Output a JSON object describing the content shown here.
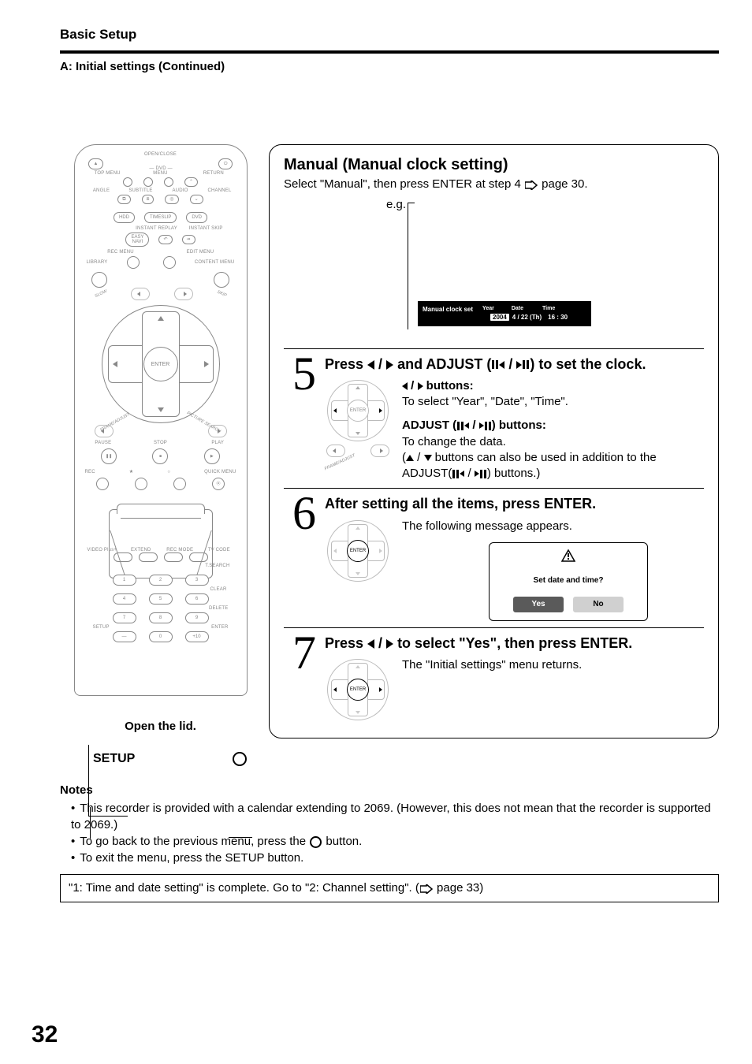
{
  "header": {
    "section": "Basic Setup",
    "subsection": "A: Initial settings (Continued)"
  },
  "remote": {
    "open_close": "OPEN/CLOSE",
    "dvd": "DVD",
    "top_menu": "TOP MENU",
    "menu": "MENU",
    "return": "RETURN",
    "angle": "ANGLE",
    "subtitle": "SUBTITLE",
    "audio": "AUDIO",
    "channel": "CHANNEL",
    "hdd": "HDD",
    "timeslip": "TIMESLIP",
    "dvd2": "DVD",
    "instant_replay": "INSTANT REPLAY",
    "instant_skip": "INSTANT SKIP",
    "easy_navi": "EASY\nNAVI",
    "rec_menu": "REC MENU",
    "edit_menu": "EDIT MENU",
    "library": "LIBRARY",
    "content_menu": "CONTENT MENU",
    "slow": "SLOW",
    "skip": "SKIP",
    "enter": "ENTER",
    "frame_adjust": "FRAME/ADJUST",
    "picture_search": "PICTURE SEARCH",
    "pause": "PAUSE",
    "stop": "STOP",
    "play": "PLAY",
    "rec": "REC",
    "quick_menu": "QUICK MENU",
    "videoplus": "VIDEO Plus+",
    "extend": "EXTEND",
    "rec_mode": "REC MODE",
    "tv_code": "TV CODE",
    "t_search": "T.SEARCH",
    "clear": "CLEAR",
    "delete": "DELETE",
    "setup": "SETUP",
    "enter2": "ENTER",
    "plus10": "+10",
    "nums": [
      "1",
      "2",
      "3",
      "4",
      "5",
      "6",
      "7",
      "8",
      "9",
      "0"
    ]
  },
  "left": {
    "open_lid": "Open the lid.",
    "setup_label": "SETUP"
  },
  "panel": {
    "title": "Manual (Manual clock setting)",
    "lead_pre": "Select \"Manual\", then press ENTER at step 4 ",
    "lead_post": " page 30.",
    "eg": "e.g.",
    "clock": {
      "label": "Manual clock set",
      "year_h": "Year",
      "date_h": "Date",
      "time_h": "Time",
      "year": "2004",
      "date": "4  / 22 (Th)",
      "time": "16 : 30"
    },
    "step5": {
      "num": "5",
      "title_pre": "Press ",
      "title_mid": " and ADJUST (",
      "title_post": ") to set the clock.",
      "btns_label": " buttons:",
      "btns_text": "To select \"Year\", \"Date\", \"Time\".",
      "adjust_label": "ADJUST (",
      "adjust_label_post": ") buttons:",
      "adjust_text1": "To change the data.",
      "adjust_text2_pre": "(",
      "adjust_text2_mid": " buttons can also be used in addition to the ADJUST(",
      "adjust_text2_post": ") buttons.)"
    },
    "step6": {
      "num": "6",
      "title": "After setting all the items, press ENTER.",
      "text": "The following message appears.",
      "confirm_msg": "Set date and time?",
      "yes": "Yes",
      "no": "No"
    },
    "step7": {
      "num": "7",
      "title_pre": "Press ",
      "title_post": " to select \"Yes\", then press ENTER.",
      "text": "The \"Initial settings\" menu returns."
    }
  },
  "notes": {
    "heading": "Notes",
    "n1": "This recorder is provided with a calendar extending to 2069. (However, this does not mean that the recorder is supported to 2069.)",
    "n2_pre": "To go back to the previous menu, press the ",
    "n2_post": " button.",
    "n3": "To exit the menu, press the SETUP button."
  },
  "done": {
    "text_pre": "\"1: Time and date setting\" is complete. Go to \"2: Channel setting\". (",
    "text_post": " page 33)"
  },
  "page_num": "32"
}
